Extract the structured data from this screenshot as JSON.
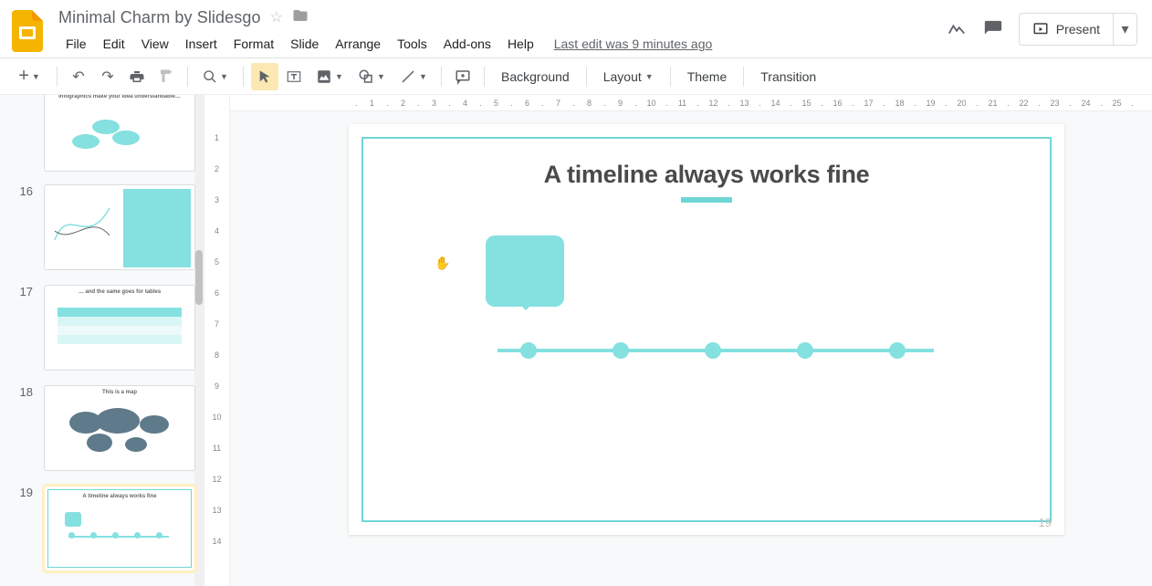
{
  "doc": {
    "title": "Minimal Charm by Slidesgo"
  },
  "header": {
    "last_edit": "Last edit was 9 minutes ago"
  },
  "menus": [
    "File",
    "Edit",
    "View",
    "Insert",
    "Format",
    "Slide",
    "Arrange",
    "Tools",
    "Add-ons",
    "Help"
  ],
  "present": {
    "label": "Present"
  },
  "toolbar": {
    "background": "Background",
    "layout": "Layout",
    "theme": "Theme",
    "transition": "Transition"
  },
  "ruler_h": [
    ".",
    "1",
    ".",
    "2",
    ".",
    "3",
    ".",
    "4",
    ".",
    "5",
    ".",
    "6",
    ".",
    "7",
    ".",
    "8",
    ".",
    "9",
    ".",
    "10",
    ".",
    "11",
    ".",
    "12",
    ".",
    "13",
    ".",
    "14",
    ".",
    "15",
    ".",
    "16",
    ".",
    "17",
    ".",
    "18",
    ".",
    "19",
    ".",
    "20",
    ".",
    "21",
    ".",
    "22",
    ".",
    "23",
    ".",
    "24",
    ".",
    "25",
    "."
  ],
  "ruler_v": [
    "1",
    "2",
    "3",
    "4",
    "5",
    "6",
    "7",
    "8",
    "9",
    "10",
    "11",
    "12",
    "13",
    "14"
  ],
  "thumbs": [
    {
      "num": "",
      "title": "Infographics make your idea understandable…"
    },
    {
      "num": "16",
      "title": ""
    },
    {
      "num": "17",
      "title": "… and the same goes for tables"
    },
    {
      "num": "18",
      "title": "This is a map"
    },
    {
      "num": "19",
      "title": "A timeline always works fine"
    }
  ],
  "slide": {
    "title": "A timeline always works fine",
    "number": "19"
  }
}
